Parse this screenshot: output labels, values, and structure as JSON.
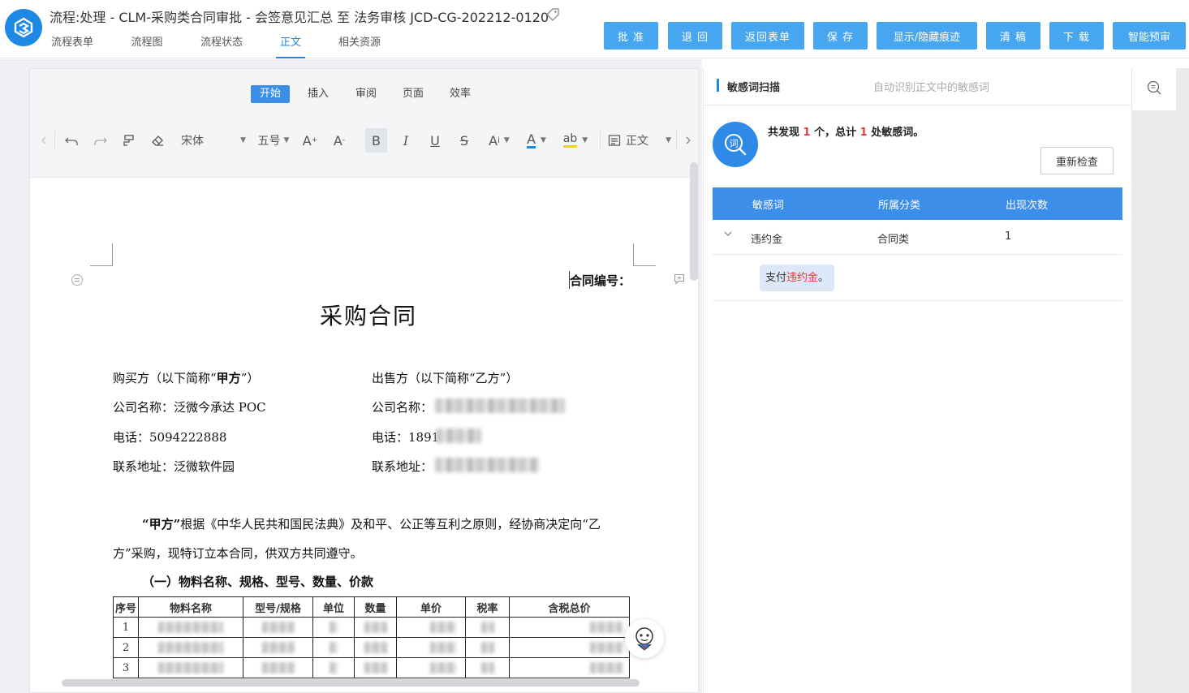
{
  "header": {
    "title": "流程:处理 - CLM-采购类合同审批 - 会签意见汇总 至 法务审核 JCD-CG-202212-0120",
    "tabs": [
      "流程表单",
      "流程图",
      "流程状态",
      "正文",
      "相关资源"
    ],
    "active_tab": "正文",
    "actions": [
      "批 准",
      "退 回",
      "返回表单",
      "保 存",
      "显示/隐藏痕迹",
      "清 稿",
      "下 载",
      "智能预审"
    ],
    "accent": "#1e88e5"
  },
  "ribbon": {
    "tabs": [
      "开始",
      "插入",
      "审阅",
      "页面",
      "效率"
    ],
    "active_tab": "开始",
    "font_name": "宋体",
    "font_size": "五号",
    "style_name": "正文"
  },
  "document": {
    "contract_no_label": "合同编号：",
    "title": "采购合同",
    "buyer_heading_pre": "购买方（以下简称“",
    "buyer_heading_bold": "甲方",
    "buyer_heading_post": "”）",
    "seller_heading": "出售方（以下简称“乙方”）",
    "buyer_company": "公司名称：泛微今承达 POC",
    "seller_company_label": "公司名称：",
    "buyer_phone": "电话：5094222888",
    "seller_phone_label": "电话：1891",
    "buyer_address": "联系地址：泛微软件园",
    "seller_address_label": "联系地址：",
    "para_bold": "“甲方”",
    "para_line1": "根据《中华人民共和国民法典》及和平、公正等互利之原则，经协商决定向“乙",
    "para_line2": "方”采购，现特订立本合同，供双方共同遵守。",
    "section1": "（一）物料名称、规格、型号、数量、价款",
    "table_headers": [
      "序号",
      "物料名称",
      "型号/规格",
      "单位",
      "数量",
      "单价",
      "税率",
      "含税总价"
    ],
    "table_rows": [
      "1",
      "2",
      "3"
    ]
  },
  "sensitive_panel": {
    "title": "敏感词扫描",
    "subtitle": "自动识别正文中的敏感词",
    "summary_pre": "共发现",
    "found_count": "1",
    "summary_mid": "个，总计",
    "total_count": "1",
    "summary_post": "处敏感词。",
    "recheck_label": "重新检查",
    "columns": [
      "敏感词",
      "所属分类",
      "出现次数"
    ],
    "rows": [
      {
        "word": "违约金",
        "category": "合同类",
        "count": "1"
      }
    ],
    "context_pre": "支付",
    "context_hit": "违约金",
    "context_post": "。"
  }
}
